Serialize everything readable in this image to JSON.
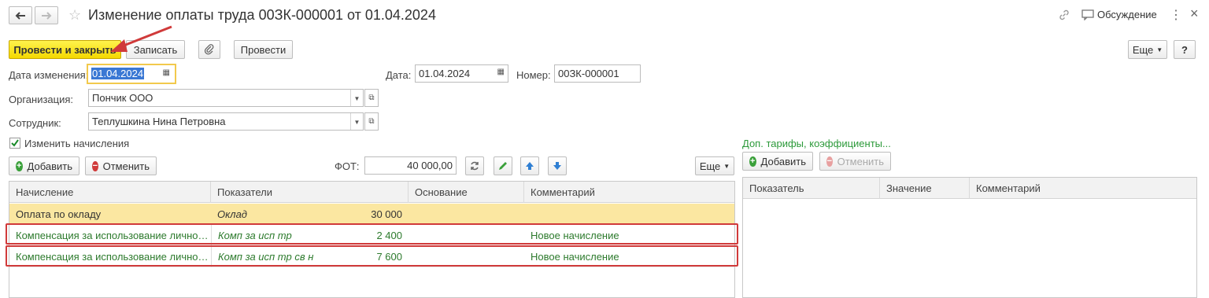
{
  "window": {
    "title": "Изменение оплаты труда 00ЗК-000001 от 01.04.2024",
    "discussion": "Обсуждение"
  },
  "toolbar": {
    "post_close": "Провести и закрыть",
    "write": "Записать",
    "post": "Провести",
    "more": "Еще",
    "help": "?"
  },
  "form": {
    "change_date_label": "Дата изменения:",
    "change_date": "01.04.2024",
    "date_label": "Дата:",
    "date": "01.04.2024",
    "number_label": "Номер:",
    "number": "00ЗК-000001",
    "org_label": "Организация:",
    "org": "Пончик ООО",
    "employee_label": "Сотрудник:",
    "employee": "Теплушкина Нина Петровна",
    "change_accruals": "Изменить начисления",
    "fot_label": "ФОТ:",
    "fot": "40 000,00"
  },
  "accruals": {
    "add": "Добавить",
    "cancel": "Отменить",
    "more": "Еще",
    "columns": [
      "Начисление",
      "Показатели",
      "Основание",
      "Комментарий"
    ],
    "rows": [
      {
        "name": "Оплата по окладу",
        "indicator": "Оклад",
        "value": "30 000",
        "basis": "",
        "comment": ""
      },
      {
        "name": "Компенсация за использование личного ...",
        "indicator": "Комп за исп тр",
        "value": "2 400",
        "basis": "",
        "comment": "Новое начисление"
      },
      {
        "name": "Компенсация за использование личного ...",
        "indicator": "Комп за исп тр св н",
        "value": "7 600",
        "basis": "",
        "comment": "Новое начисление"
      }
    ]
  },
  "extra": {
    "title": "Доп. тарифы, коэффициенты...",
    "add": "Добавить",
    "cancel": "Отменить",
    "columns": [
      "Показатель",
      "Значение",
      "Комментарий"
    ]
  },
  "colors": {
    "primary": "#f4d800",
    "green_text": "#2c7a2c",
    "highlight_row": "#fbe7a1",
    "annotation_red": "#d03a3a"
  }
}
